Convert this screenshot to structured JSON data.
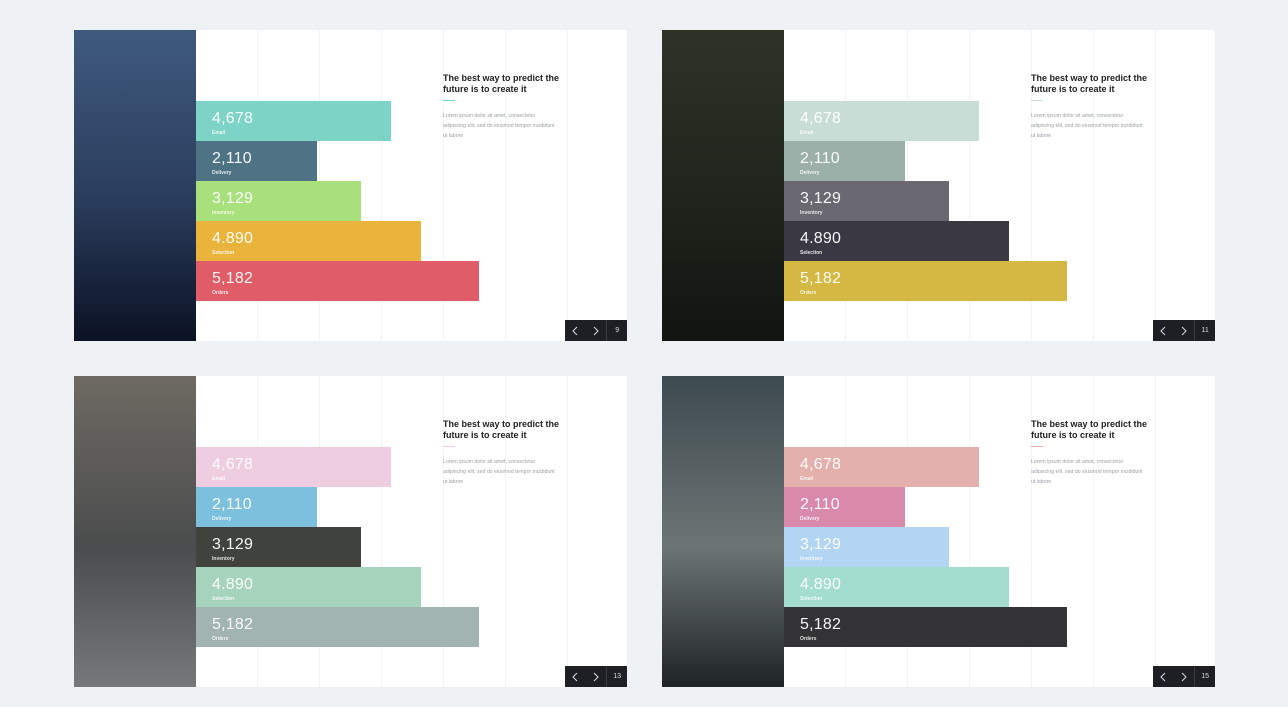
{
  "heading": "The best way to predict the future is to create it",
  "body": "Lorem ipsum dolor sit amet, consectetur adipiscing elit, sed do eiusmod tempor incididunt ut labore",
  "slides": [
    {
      "page": "9",
      "photo_colors": [
        "#3f5a7e",
        "#2a3c5c",
        "#0b1224"
      ],
      "accent": "#7dd3c6",
      "bars": [
        {
          "value": "4,678",
          "label": "Email",
          "color": "#7dd3c6"
        },
        {
          "value": "2,110",
          "label": "Delivery",
          "color": "#4d7384"
        },
        {
          "value": "3,129",
          "label": "Inventory",
          "color": "#a8e07c"
        },
        {
          "value": "4.890",
          "label": "Selection",
          "color": "#eab33c"
        },
        {
          "value": "5,182",
          "label": "Orders",
          "color": "#e05d67"
        }
      ]
    },
    {
      "page": "11",
      "photo_colors": [
        "#2e3328",
        "#1f241c",
        "#111410"
      ],
      "accent": "#c8ddd6",
      "bars": [
        {
          "value": "4,678",
          "label": "Email",
          "color": "#c8ddd6"
        },
        {
          "value": "2,110",
          "label": "Delivery",
          "color": "#9cb0aa"
        },
        {
          "value": "3,129",
          "label": "Inventory",
          "color": "#6a6871"
        },
        {
          "value": "4.890",
          "label": "Selection",
          "color": "#3a3843"
        },
        {
          "value": "5,182",
          "label": "Orders",
          "color": "#d5b843"
        }
      ]
    },
    {
      "page": "13",
      "photo_colors": [
        "#6e6a63",
        "#4a4c4d",
        "#77787a"
      ],
      "accent": "#efcde1",
      "bars": [
        {
          "value": "4,678",
          "label": "Email",
          "color": "#efcde1"
        },
        {
          "value": "2,110",
          "label": "Delivery",
          "color": "#7cc0de"
        },
        {
          "value": "3,129",
          "label": "Inventory",
          "color": "#3f423d"
        },
        {
          "value": "4.890",
          "label": "Selection",
          "color": "#a6d3bc"
        },
        {
          "value": "5,182",
          "label": "Orders",
          "color": "#a1b4b0"
        }
      ]
    },
    {
      "page": "15",
      "photo_colors": [
        "#3d4a50",
        "#6d7474",
        "#1e2426"
      ],
      "accent": "#e4b0ab",
      "bars": [
        {
          "value": "4,678",
          "label": "Email",
          "color": "#e4b0ab"
        },
        {
          "value": "2,110",
          "label": "Delivery",
          "color": "#d98aab"
        },
        {
          "value": "3,129",
          "label": "Inventory",
          "color": "#b2d5f4"
        },
        {
          "value": "4.890",
          "label": "Selection",
          "color": "#a2ddd0"
        },
        {
          "value": "5,182",
          "label": "Orders",
          "color": "#333335"
        }
      ]
    }
  ],
  "icons": {
    "prev": "chevron-left-icon",
    "next": "chevron-right-icon"
  }
}
